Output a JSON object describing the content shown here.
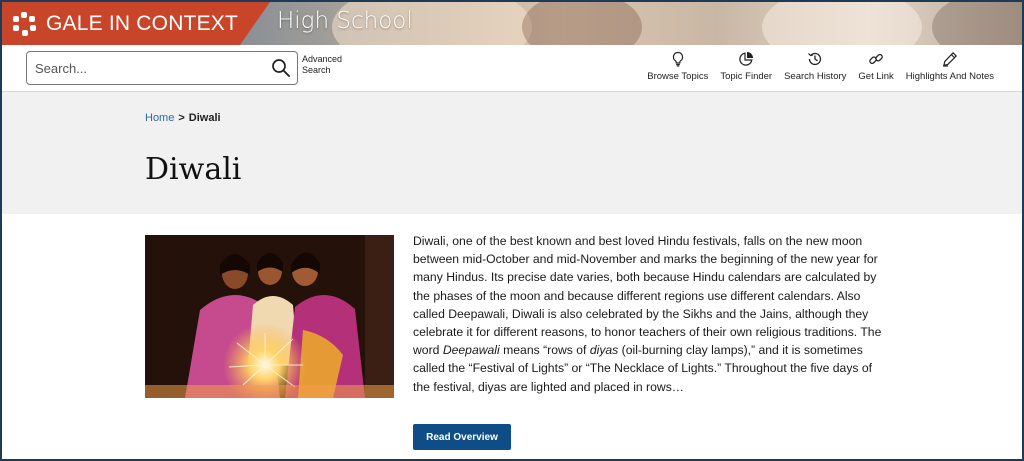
{
  "brand": {
    "name": "GALE IN CONTEXT",
    "product": "High School",
    "color": "#c8452a"
  },
  "search": {
    "placeholder": "Search...",
    "advanced_label": "Advanced Search"
  },
  "toolbar": {
    "items": [
      {
        "label": "Browse Topics",
        "icon": "lightbulb-icon"
      },
      {
        "label": "Topic Finder",
        "icon": "pie-chart-icon"
      },
      {
        "label": "Search History",
        "icon": "history-icon"
      },
      {
        "label": "Get Link",
        "icon": "link-icon"
      },
      {
        "label": "Highlights And Notes",
        "icon": "pencil-icon"
      }
    ]
  },
  "breadcrumb": {
    "home": "Home",
    "separator": ">",
    "current": "Diwali"
  },
  "page": {
    "title": "Diwali"
  },
  "overview": {
    "image_alt": "girls lighting sparklers",
    "button_label": "Read Overview",
    "button_color": "#0f4d86",
    "text_parts": [
      "Diwali, one of the best known and best loved Hindu festivals, falls on the new moon between mid-October and mid-November and marks the beginning of the new year for many Hindus. Its precise date varies, both because Hindu calendars are calculated by the phases of the moon and because different regions use different calendars. Also called Deepawali, Diwali is also celebrated by the Sikhs and the Jains, although they celebrate it for different reasons, to honor teachers of their own religious traditions. The word ",
      "Deepawali",
      " means “rows of ",
      "diyas",
      " (oil-burning clay lamps),” and it is sometimes called the “Festival of Lights” or “The Necklace of Lights.” Throughout the five days of the festival, diyas are lighted and placed in rows…"
    ]
  }
}
